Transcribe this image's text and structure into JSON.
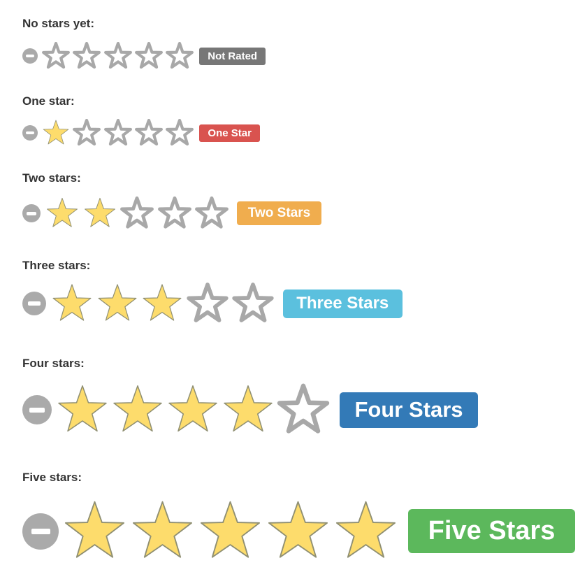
{
  "max_stars": 5,
  "colors": {
    "filled_star": "#fddc6c",
    "empty_star_stroke": "#a8a8a8",
    "clear_button": "#aaaaaa"
  },
  "ratings": [
    {
      "label": "No stars yet:",
      "value": 0,
      "badge": "Not Rated",
      "badge_color": "#777777"
    },
    {
      "label": "One star:",
      "value": 1,
      "badge": "One Star",
      "badge_color": "#d9534f"
    },
    {
      "label": "Two stars:",
      "value": 2,
      "badge": "Two Stars",
      "badge_color": "#f0ad4e"
    },
    {
      "label": "Three stars:",
      "value": 3,
      "badge": "Three Stars",
      "badge_color": "#5bc0de"
    },
    {
      "label": "Four stars:",
      "value": 4,
      "badge": "Four Stars",
      "badge_color": "#337ab7"
    },
    {
      "label": "Five stars:",
      "value": 5,
      "badge": "Five Stars",
      "badge_color": "#5cb85c"
    }
  ]
}
